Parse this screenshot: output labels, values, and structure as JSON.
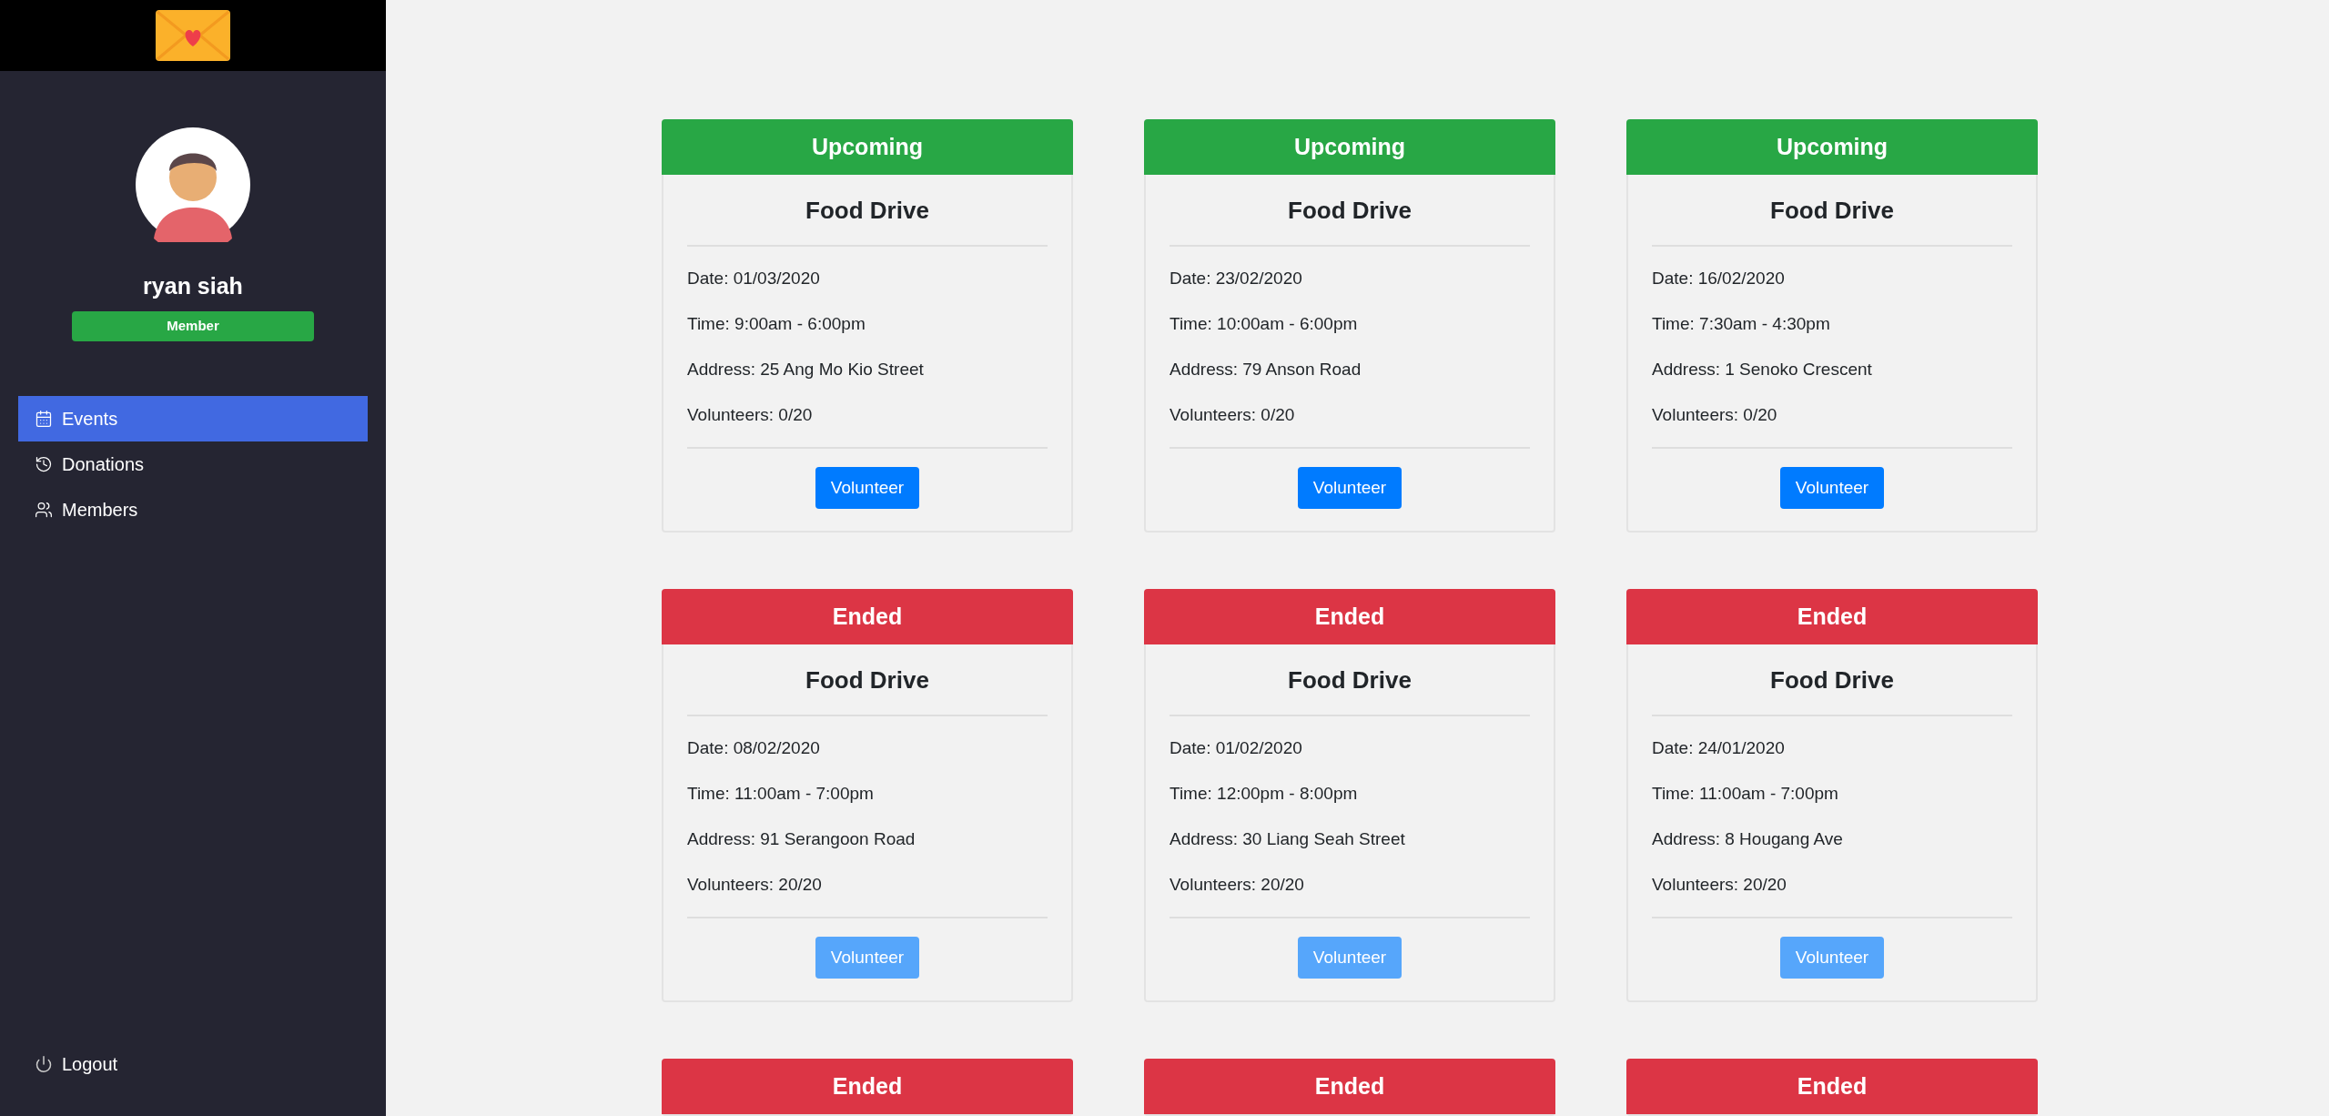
{
  "sidebar": {
    "user": {
      "name": "ryan siah",
      "role": "Member"
    },
    "nav": [
      {
        "label": "Events",
        "selected": true
      },
      {
        "label": "Donations",
        "selected": false
      },
      {
        "label": "Members",
        "selected": false
      }
    ],
    "logout": "Logout"
  },
  "events": [
    {
      "status": "Upcoming",
      "kind": "upcoming",
      "title": "Food Drive",
      "details": [
        "Date: 01/03/2020",
        "Time: 9:00am - 6:00pm",
        "Address: 25 Ang Mo Kio Street",
        "Volunteers: 0/20"
      ],
      "button": {
        "label": "Volunteer",
        "disabled": false
      }
    },
    {
      "status": "Upcoming",
      "kind": "upcoming",
      "title": "Food Drive",
      "details": [
        "Date: 23/02/2020",
        "Time: 10:00am - 6:00pm",
        "Address: 79 Anson Road",
        "Volunteers: 0/20"
      ],
      "button": {
        "label": "Volunteer",
        "disabled": false
      }
    },
    {
      "status": "Upcoming",
      "kind": "upcoming",
      "title": "Food Drive",
      "details": [
        "Date: 16/02/2020",
        "Time: 7:30am - 4:30pm",
        "Address: 1 Senoko Crescent",
        "Volunteers: 0/20"
      ],
      "button": {
        "label": "Volunteer",
        "disabled": false
      }
    },
    {
      "status": "Ended",
      "kind": "ended",
      "title": "Food Drive",
      "details": [
        "Date: 08/02/2020",
        "Time: 11:00am - 7:00pm",
        "Address: 91 Serangoon Road",
        "Volunteers: 20/20"
      ],
      "button": {
        "label": "Volunteer",
        "disabled": true
      }
    },
    {
      "status": "Ended",
      "kind": "ended",
      "title": "Food Drive",
      "details": [
        "Date: 01/02/2020",
        "Time: 12:00pm - 8:00pm",
        "Address: 30 Liang Seah Street",
        "Volunteers: 20/20"
      ],
      "button": {
        "label": "Volunteer",
        "disabled": true
      }
    },
    {
      "status": "Ended",
      "kind": "ended",
      "title": "Food Drive",
      "details": [
        "Date: 24/01/2020",
        "Time: 11:00am - 7:00pm",
        "Address: 8 Hougang Ave",
        "Volunteers: 20/20"
      ],
      "button": {
        "label": "Volunteer",
        "disabled": true
      }
    },
    {
      "status": "Ended",
      "kind": "ended"
    },
    {
      "status": "Ended",
      "kind": "ended"
    },
    {
      "status": "Ended",
      "kind": "ended"
    }
  ]
}
